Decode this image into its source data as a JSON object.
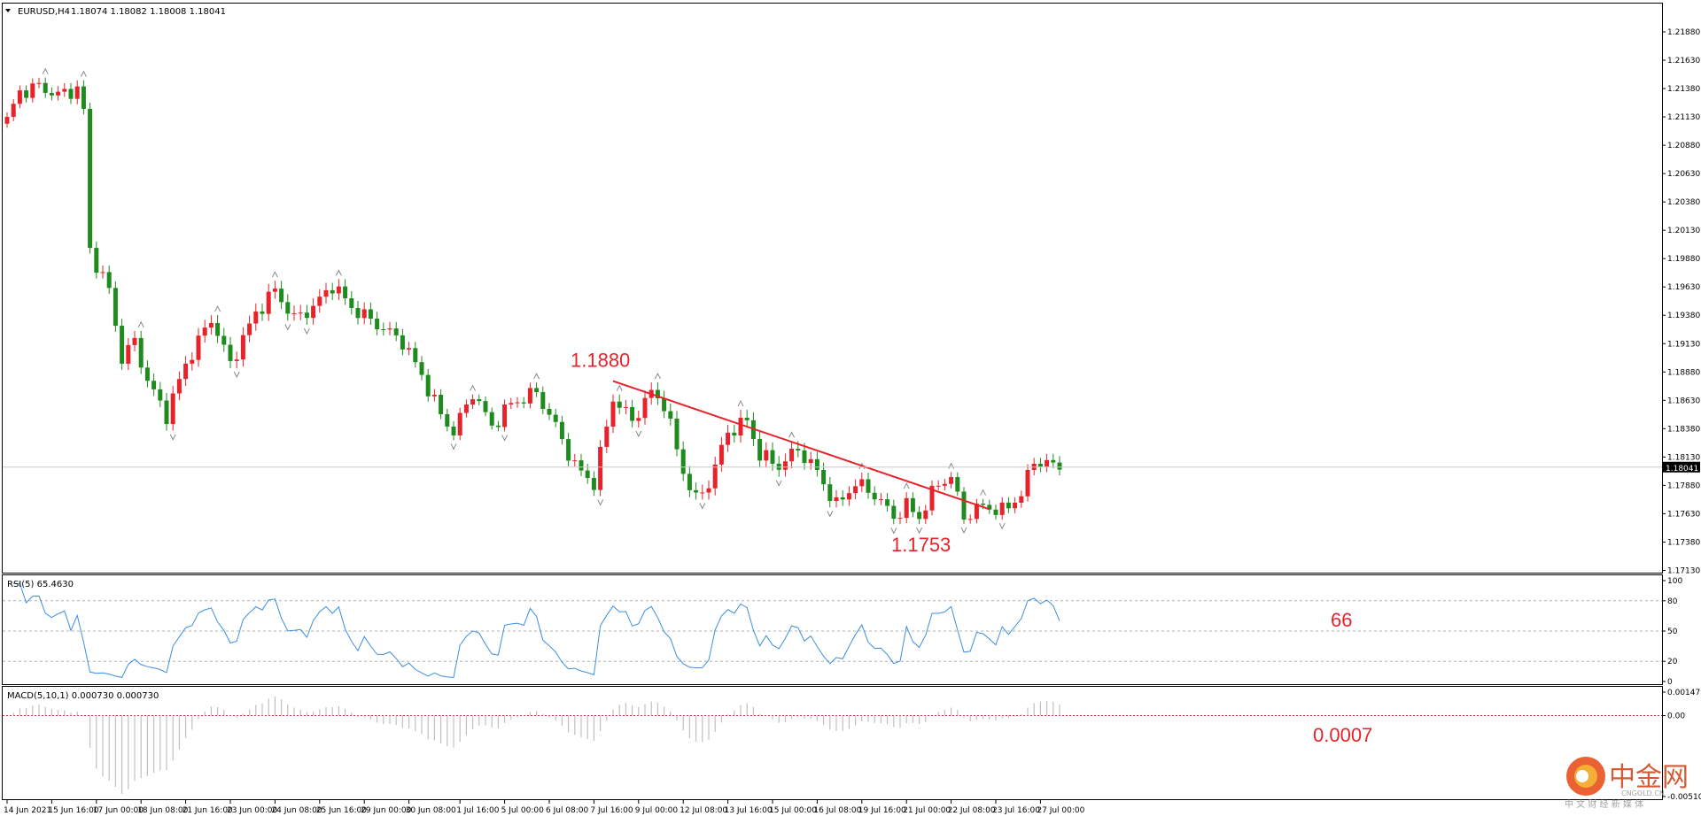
{
  "chart_data": [
    {
      "type": "candlestick",
      "header": {
        "symbol": "EURUSD,H4",
        "ohlc": "1.18074 1.18082 1.18008 1.18041"
      },
      "ylim": [
        1.1711,
        1.2213
      ],
      "y_ticks": [
        "1.21880",
        "1.21630",
        "1.21380",
        "1.21130",
        "1.20880",
        "1.20630",
        "1.20380",
        "1.20130",
        "1.19880",
        "1.19630",
        "1.19380",
        "1.19130",
        "1.18880",
        "1.18630",
        "1.18380",
        "1.18130",
        "1.17880",
        "1.17630",
        "1.17380",
        "1.17130"
      ],
      "y_tick_values": [
        1.2188,
        1.2163,
        1.2138,
        1.2113,
        1.2088,
        1.2063,
        1.2038,
        1.2013,
        1.1988,
        1.1963,
        1.1938,
        1.1913,
        1.1888,
        1.1863,
        1.1838,
        1.1813,
        1.1788,
        1.1763,
        1.1738,
        1.1713
      ],
      "current_price": {
        "label": "1.18041",
        "value": 1.18041
      },
      "trendline": {
        "from": [
          95,
          1.188
        ],
        "to": [
          154,
          1.1767
        ]
      },
      "annotations": [
        {
          "text": "1.1880",
          "x": 95,
          "y": 1.188
        },
        {
          "text": "1.1753",
          "x": 140,
          "y": 1.1753
        }
      ],
      "colors": {
        "up": "#e8222a",
        "down": "#1f8b1f",
        "trendline": "#e8222a",
        "annotation": "#e8222a"
      }
    },
    {
      "type": "line",
      "name": "RSI(5) 65.4630",
      "ylim": [
        0,
        100
      ],
      "y_ticks": [
        "100",
        "80",
        "50",
        "20",
        "0"
      ],
      "y_tick_values": [
        100,
        80,
        50,
        20,
        0
      ],
      "levels": [
        80,
        50,
        20
      ],
      "annotation": "66",
      "color": "#3b8fe0"
    },
    {
      "type": "bar",
      "name": "MACD(5,10,1) 0.000730 0.000730",
      "ylim": [
        -0.005101,
        0.001479
      ],
      "y_ticks": [
        "0.001479",
        "0.00",
        "-0.005101"
      ],
      "y_tick_values": [
        0.001479,
        0,
        -0.005101
      ],
      "annotation": "0.0007",
      "color": "#c0c0c0"
    }
  ],
  "x_axis": {
    "labels": [
      "14 Jun 2021",
      "15 Jun 16:00",
      "17 Jun 00:00",
      "18 Jun 08:00",
      "21 Jun 16:00",
      "23 Jun 00:00",
      "24 Jun 08:00",
      "25 Jun 16:00",
      "29 Jun 00:00",
      "30 Jun 08:00",
      "1 Jul 16:00",
      "5 Jul 00:00",
      "6 Jul 08:00",
      "7 Jul 16:00",
      "9 Jul 00:00",
      "12 Jul 08:00",
      "13 Jul 16:00",
      "15 Jul 00:00",
      "16 Jul 08:00",
      "19 Jul 16:00",
      "21 Jul 00:00",
      "22 Jul 08:00",
      "23 Jul 16:00",
      "27 Jul 00:00"
    ]
  },
  "watermark": {
    "logo_text": "中金网",
    "site": "CNGOLD.CN",
    "sub": "中 文 财 经 新 媒 体",
    "colors": [
      "#e8501f",
      "#f5a623"
    ]
  }
}
